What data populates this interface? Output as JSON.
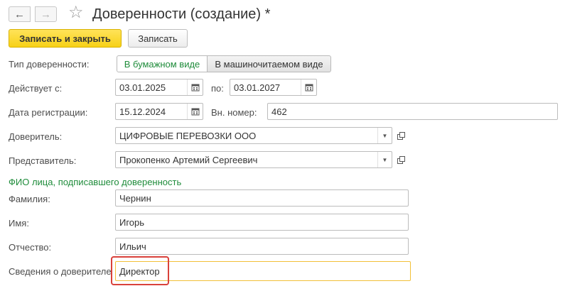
{
  "window": {
    "title": "Доверенности (создание) *",
    "back_icon": "←",
    "forward_icon": "→",
    "favorite_icon": "☆"
  },
  "toolbar": {
    "save_and_close_label": "Записать и закрыть",
    "save_label": "Записать"
  },
  "form": {
    "type_label": "Тип доверенности:",
    "type_options": [
      "В бумажном виде",
      "В машиночитаемом виде"
    ],
    "type_selected": "В бумажном виде",
    "valid_from_label": "Действует с:",
    "valid_from_value": "03.01.2025",
    "valid_to_label": "по:",
    "valid_to_value": "03.01.2027",
    "reg_date_label": "Дата регистрации:",
    "reg_date_value": "15.12.2024",
    "internal_number_label": "Вн. номер:",
    "internal_number_value": "462",
    "principal_label": "Доверитель:",
    "principal_value": "ЦИФРОВЫЕ ПЕРЕВОЗКИ ООО",
    "representative_label": "Представитель:",
    "representative_value": "Прокопенко Артемий Сергеевич"
  },
  "signer": {
    "section_title": "ФИО лица, подписавшего доверенность",
    "last_name_label": "Фамилия:",
    "last_name_value": "Чернин",
    "first_name_label": "Имя:",
    "first_name_value": "Игорь",
    "middle_name_label": "Отчество:",
    "middle_name_value": "Ильич",
    "info_label": "Сведения о доверителе",
    "info_value": "Директор"
  },
  "colors": {
    "accent_green": "#1f8c3b",
    "primary_button": "#f7d117",
    "highlight_red": "#d9413b",
    "active_field_border": "#f2c037"
  }
}
